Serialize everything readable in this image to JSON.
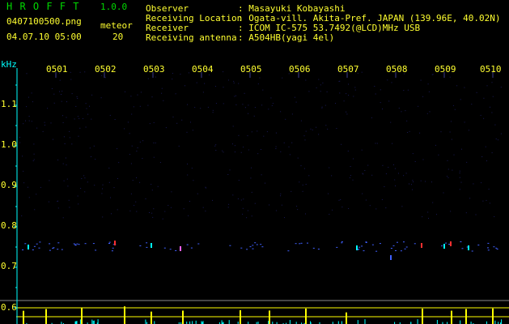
{
  "app": {
    "name": "H R O F F T",
    "version": "1.0.0"
  },
  "file": {
    "name": "0407100500.png",
    "datetime": "04.07.10 05:00"
  },
  "meteor": {
    "label": "meteor",
    "count": "20"
  },
  "info": [
    {
      "label": "Observer",
      "value": ": Masayuki Kobayashi"
    },
    {
      "label": "Receiving Location",
      "value": ": Ogata-vill. Akita-Pref. JAPAN (139.96E, 40.02N)"
    },
    {
      "label": "Receiver",
      "value": ": ICOM IC-575 53.7492(@LCD)MHz USB"
    },
    {
      "label": "Receiving antenna",
      "value": ": A504HB(yagi 4el)"
    }
  ],
  "axis": {
    "unit": "kHz",
    "y_ticks": [
      "1.1",
      "1.0",
      "0.9",
      "0.8",
      "0.7",
      "0.6"
    ],
    "x_ticks": [
      "0501",
      "0502",
      "0503",
      "0504",
      "0505",
      "0506",
      "0507",
      "0508",
      "0509",
      "0510"
    ]
  },
  "colors": {
    "header_text": "#ffff30",
    "title": "#00d800",
    "axis": "#00ffff",
    "background": "#000000",
    "noise": "#1a1a55",
    "meteor_trace": "#4060ff",
    "meteor_hot": "#ff3030",
    "activity_yellow": "#ffff00",
    "activity_cyan": "#00ffff"
  }
}
